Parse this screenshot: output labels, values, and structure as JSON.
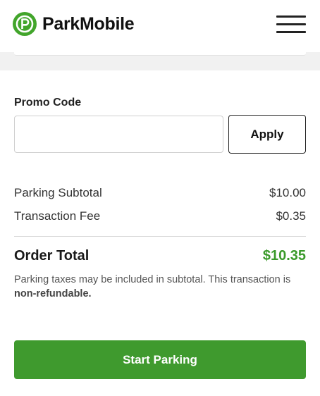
{
  "header": {
    "brand_name": "ParkMobile",
    "brand_color": "#42a52b",
    "logo_icon": "parkmobile-p-logo-icon",
    "menu_icon": "hamburger-menu-icon"
  },
  "promo": {
    "label": "Promo Code",
    "input_value": "",
    "input_placeholder": "",
    "apply_label": "Apply"
  },
  "summary": {
    "parking_subtotal_label": "Parking Subtotal",
    "parking_subtotal_value": "$10.00",
    "transaction_fee_label": "Transaction Fee",
    "transaction_fee_value": "$0.35",
    "order_total_label": "Order Total",
    "order_total_value": "$10.35",
    "order_total_color": "#3a9a2a"
  },
  "disclaimer": {
    "text": "Parking taxes may be included in subtotal. This transaction is ",
    "emphasis": "non-refundable."
  },
  "actions": {
    "start_parking_label": "Start Parking",
    "start_parking_color": "#3f9a2e"
  }
}
